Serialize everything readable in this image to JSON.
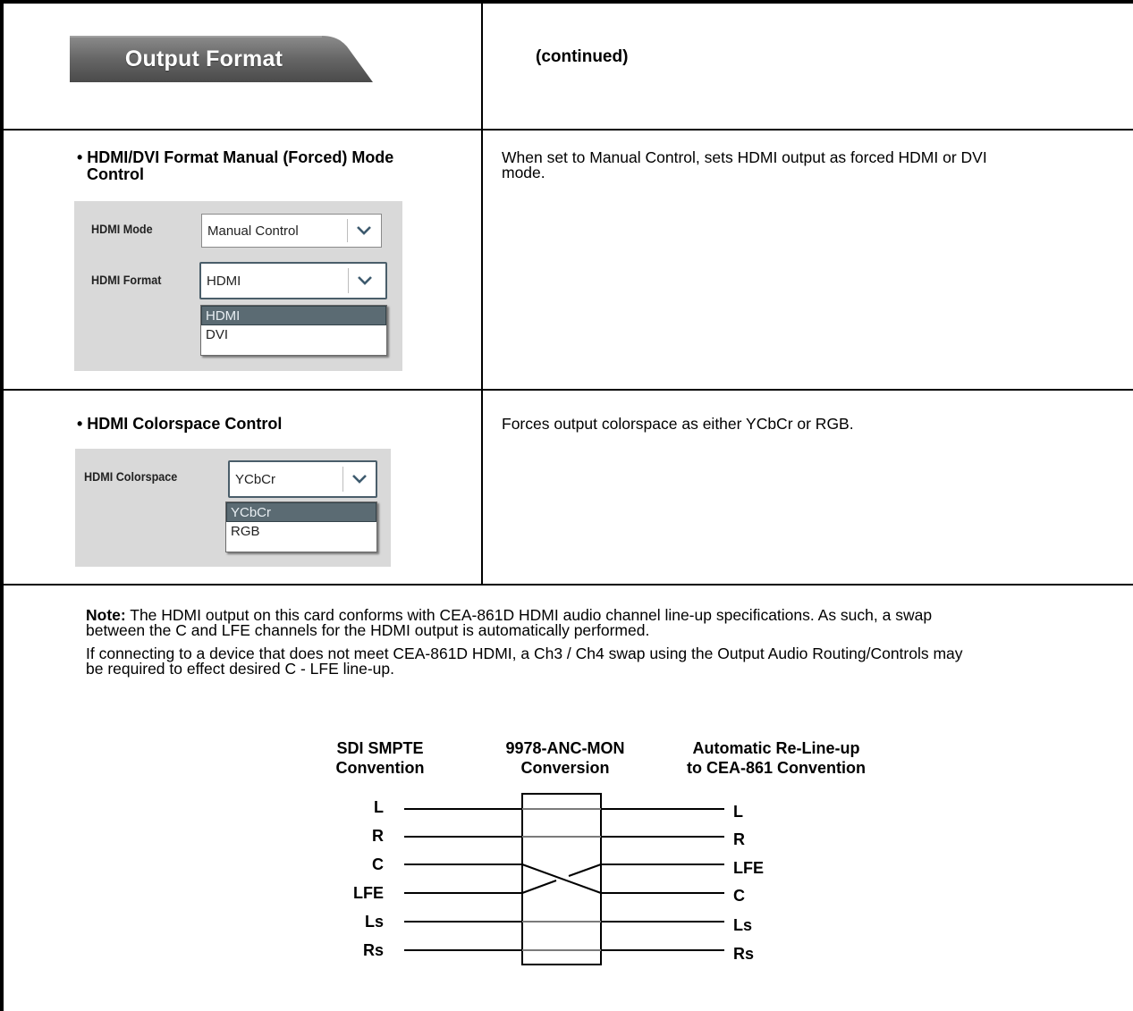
{
  "header": {
    "tab_label": "Output Format",
    "continued": "(continued)"
  },
  "rows": [
    {
      "title_line1": "• HDMI/DVI Format Manual (Forced) Mode",
      "title_line2": "Control",
      "description_line1": "When set to Manual Control, sets HDMI output as forced HDMI or DVI",
      "description_line2": "mode.",
      "gui": {
        "mode_label": "HDMI Mode",
        "mode_value": "Manual Control",
        "format_label": "HDMI Format",
        "format_value": "HDMI",
        "options": [
          "HDMI",
          "DVI"
        ]
      }
    },
    {
      "title_line1": "• HDMI Colorspace Control",
      "description_line1": "Forces output colorspace as either YCbCr or RGB.",
      "gui": {
        "colorspace_label": "HDMI Colorspace",
        "colorspace_value": "YCbCr",
        "options": [
          "YCbCr",
          "RGB"
        ]
      }
    }
  ],
  "note": {
    "bold_prefix": "Note:",
    "p1_line1": " The HDMI output on this card conforms with CEA-861D HDMI audio channel line-up specifications. As such, a swap",
    "p1_line2": "between the C and LFE channels for the HDMI output is automatically performed.",
    "p2_line1": "If connecting to a device that does not meet CEA-861D HDMI, a Ch3 / Ch4 swap using the Output Audio Routing/Controls may",
    "p2_line2": "be required to effect desired C - LFE line-up."
  },
  "diagram": {
    "col1_line1": "SDI SMPTE",
    "col1_line2": "Convention",
    "col2_line1": "9978-ANC-MON",
    "col2_line2": "Conversion",
    "col3_line1": "Automatic Re-Line-up",
    "col3_line2": "to CEA-861 Convention",
    "inputs": [
      "L",
      "R",
      "C",
      "LFE",
      "Ls",
      "Rs"
    ],
    "outputs": [
      "L",
      "R",
      "LFE",
      "C",
      "Ls",
      "Rs"
    ]
  }
}
